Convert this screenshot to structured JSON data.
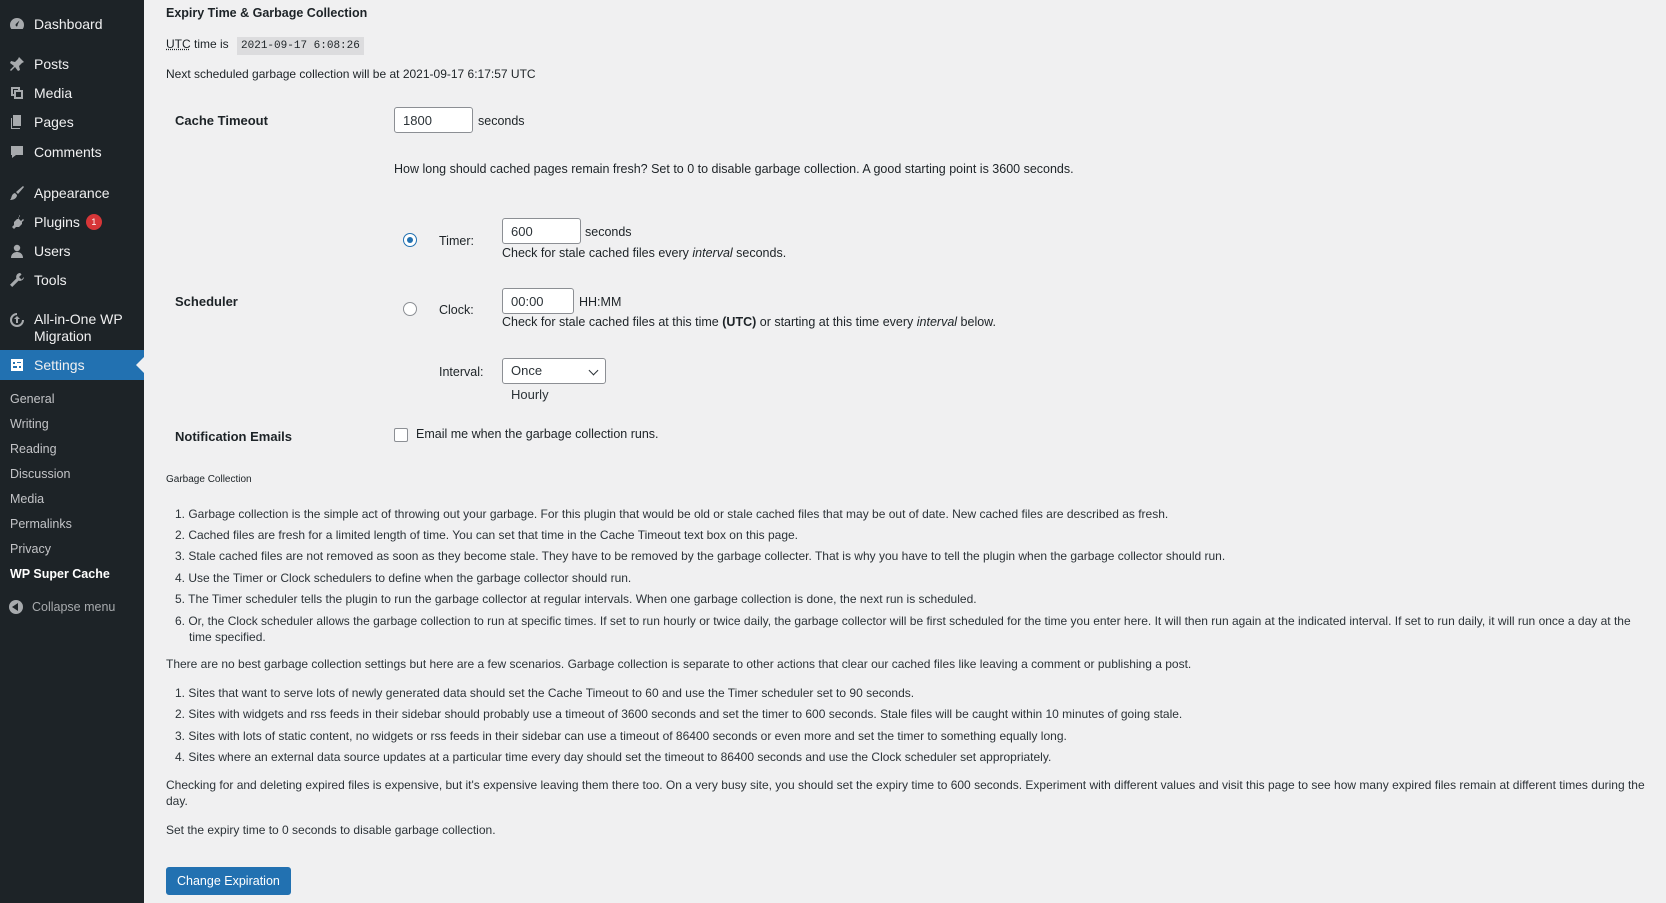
{
  "sidebar": {
    "menu": [
      {
        "label": "Dashboard",
        "icon": "dashboard-icon"
      },
      {
        "label": "Posts",
        "icon": "pin-icon"
      },
      {
        "label": "Media",
        "icon": "media-icon"
      },
      {
        "label": "Pages",
        "icon": "pages-icon"
      },
      {
        "label": "Comments",
        "icon": "comments-icon"
      },
      {
        "label": "Appearance",
        "icon": "brush-icon"
      },
      {
        "label": "Plugins",
        "icon": "plugin-icon",
        "badge": "1"
      },
      {
        "label": "Users",
        "icon": "users-icon"
      },
      {
        "label": "Tools",
        "icon": "wrench-icon"
      },
      {
        "label": "All-in-One WP",
        "label2": "Migration",
        "icon": "migration-icon"
      },
      {
        "label": "Settings",
        "icon": "settings-icon"
      }
    ],
    "submenu": [
      "General",
      "Writing",
      "Reading",
      "Discussion",
      "Media",
      "Permalinks",
      "Privacy",
      "WP Super Cache"
    ],
    "collapse_label": "Collapse menu"
  },
  "main": {
    "heading": "Expiry Time & Garbage Collection",
    "utc_prefix": "UTC",
    "utc_suffix": "time is",
    "utc_time": "2021-09-17 6:08:26",
    "next_gc_prefix": "Next scheduled garbage collection will be at",
    "next_gc_time": "2021-09-17 6:17:57 UTC",
    "cache_timeout": {
      "label": "Cache Timeout",
      "value": "1800",
      "unit": "seconds",
      "help": "How long should cached pages remain fresh? Set to 0 to disable garbage collection. A good starting point is 3600 seconds."
    },
    "scheduler": {
      "label": "Scheduler",
      "timer_label": "Timer:",
      "timer_value": "600",
      "timer_unit": "seconds",
      "timer_help_a": "Check for stale cached files every",
      "timer_help_em": "interval",
      "timer_help_b": "seconds.",
      "clock_label": "Clock:",
      "clock_value": "00:00",
      "clock_unit": "HH:MM",
      "clock_help_a": "Check for stale cached files at this time",
      "clock_help_strong": "(UTC)",
      "clock_help_b": "or starting at this time every",
      "clock_help_em": "interval",
      "clock_help_c": "below.",
      "interval_label": "Interval:",
      "interval_value": "Once Hourly"
    },
    "notification": {
      "label": "Notification Emails",
      "checkbox_label": "Email me when the garbage collection runs."
    },
    "gc_heading": "Garbage Collection",
    "gc_list": [
      "1. Garbage collection is the simple act of throwing out your garbage. For this plugin that would be old or stale cached files that may be out of date. New cached files are described as fresh.",
      "2. Cached files are fresh for a limited length of time. You can set that time in the Cache Timeout text box on this page.",
      "3. Stale cached files are not removed as soon as they become stale. They have to be removed by the garbage collecter. That is why you have to tell the plugin when the garbage collector should run.",
      "4. Use the Timer or Clock schedulers to define when the garbage collector should run.",
      "5. The Timer scheduler tells the plugin to run the garbage collector at regular intervals. When one garbage collection is done, the next run is scheduled.",
      "6. Or, the Clock scheduler allows the garbage collection to run at specific times. If set to run hourly or twice daily, the garbage collector will be first scheduled for the time you enter here. It will then run again at the indicated interval. If set to run daily, it will run once a day at the",
      "time specified."
    ],
    "scenarios_intro": "There are no best garbage collection settings but here are a few scenarios. Garbage collection is separate to other actions that clear our cached files like leaving a comment or publishing a post.",
    "scenarios": [
      "1. Sites that want to serve lots of newly generated data should set the Cache Timeout to 60 and use the Timer scheduler set to 90 seconds.",
      "2. Sites with widgets and rss feeds in their sidebar should probably use a timeout of 3600 seconds and set the timer to 600 seconds. Stale files will be caught within 10 minutes of going stale.",
      "3. Sites with lots of static content, no widgets or rss feeds in their sidebar can use a timeout of 86400 seconds or even more and set the timer to something equally long.",
      "4. Sites where an external data source updates at a particular time every day should set the timeout to 86400 seconds and use the Clock scheduler set appropriately."
    ],
    "checking_para_1": "Checking for and deleting expired files is expensive, but it's expensive leaving them there too. On a very busy site, you should set the expiry time to 600 seconds. Experiment with different values and visit this page to see how many expired files remain at different times during the",
    "checking_para_2": "day.",
    "disable_note": "Set the expiry time to 0 seconds to disable garbage collection.",
    "submit_label": "Change Expiration"
  },
  "colors": {
    "sidebar_bg": "#1d2327",
    "accent": "#2271b1",
    "badge": "#d63638",
    "page_bg": "#f0f0f1"
  }
}
